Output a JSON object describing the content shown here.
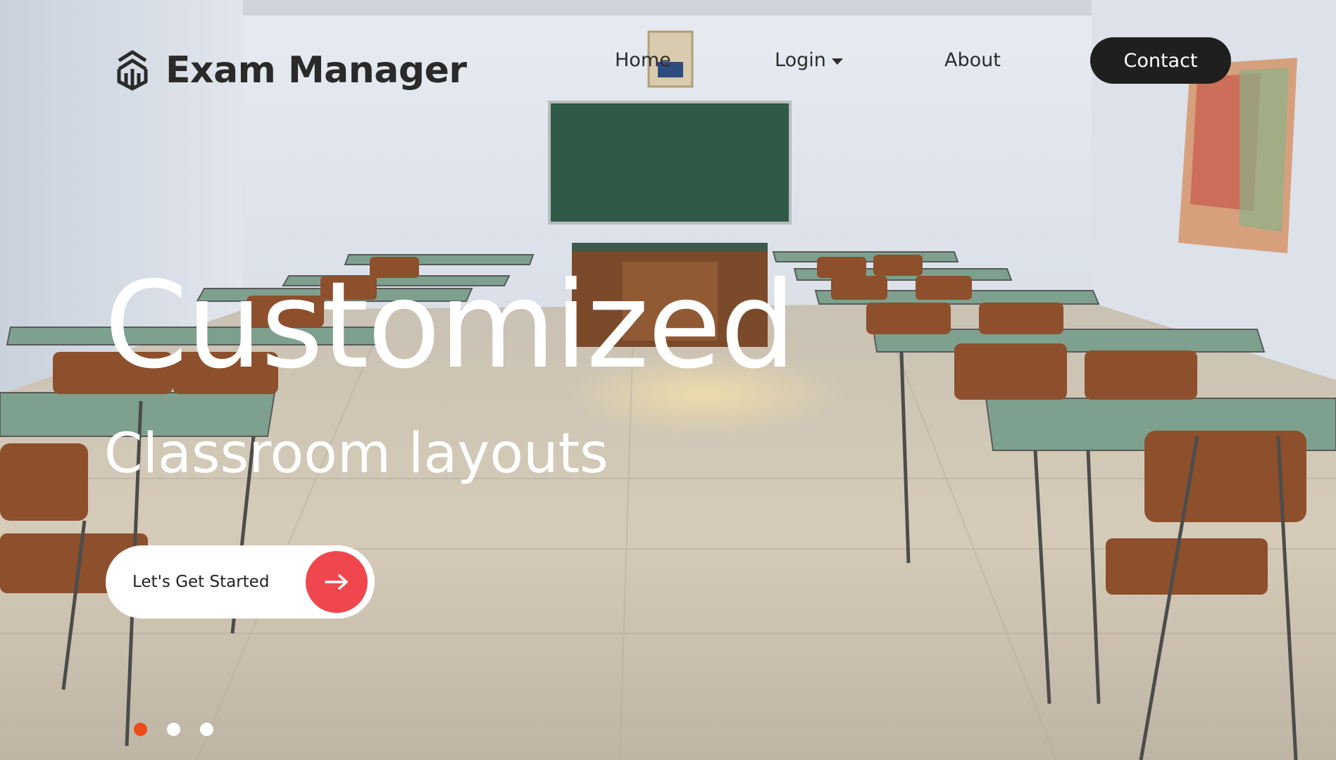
{
  "brand": {
    "name": "Exam Manager",
    "logo_icon": "cube-stack-icon"
  },
  "nav": {
    "home": "Home",
    "login": "Login",
    "about": "About",
    "contact": "Contact"
  },
  "hero": {
    "title": "Customized",
    "subtitle": "Classroom layouts",
    "cta_label": "Let's Get Started",
    "cta_icon": "arrow-right-icon"
  },
  "slider": {
    "count": 3,
    "active_index": 0
  },
  "colors": {
    "accent": "#f0474e",
    "active_dot": "#ef4b16",
    "dark": "#1f1f1f"
  }
}
